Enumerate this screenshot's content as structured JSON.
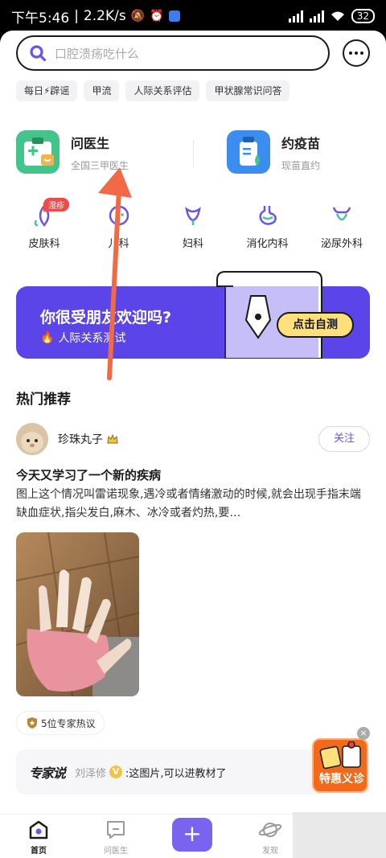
{
  "status_bar": {
    "time": "下午5:46",
    "speed": "2.2K/s",
    "battery": "32"
  },
  "search": {
    "placeholder": "口腔溃疡吃什么"
  },
  "chips": [
    "每日⚡辟谣",
    "甲流",
    "人际关系评估",
    "甲状腺常识问答"
  ],
  "services": [
    {
      "title": "问医生",
      "subtitle": "全国三甲医生"
    },
    {
      "title": "约疫苗",
      "subtitle": "现苗直约"
    }
  ],
  "departments": [
    {
      "label": "皮肤科",
      "badge": "湿疹"
    },
    {
      "label": "儿科",
      "badge": ""
    },
    {
      "label": "妇科",
      "badge": ""
    },
    {
      "label": "消化内科",
      "badge": ""
    },
    {
      "label": "泌尿外科",
      "badge": ""
    }
  ],
  "banner": {
    "title": "你很受朋友欢迎吗?",
    "subtitle": "人际关系测试",
    "button": "点击自测"
  },
  "section_title": "热门推荐",
  "post": {
    "author": "珍珠丸子",
    "follow": "关注",
    "title": "今天又学习了一个新的疾病",
    "body": "图上这个情况叫雷诺现象,遇冷或者情绪激动的时候,就会出现手指末端缺血症状,指尖发白,麻木、冰冷或者灼热,要…",
    "expert_count": "5位专家热议"
  },
  "expert_comment": {
    "brand": "专家说",
    "name": "刘泽修",
    "text": ":这图片,可以进教材了"
  },
  "promo": {
    "label": "特惠义诊"
  },
  "tabs": [
    {
      "label": "首页",
      "active": true
    },
    {
      "label": "问医生",
      "active": false
    },
    {
      "label": "发现",
      "active": false
    }
  ],
  "colors": {
    "accent": "#5b44e8",
    "button_yellow": "#ffe07a",
    "promo_orange": "#f16a1c",
    "arrow": "#f06b45"
  }
}
